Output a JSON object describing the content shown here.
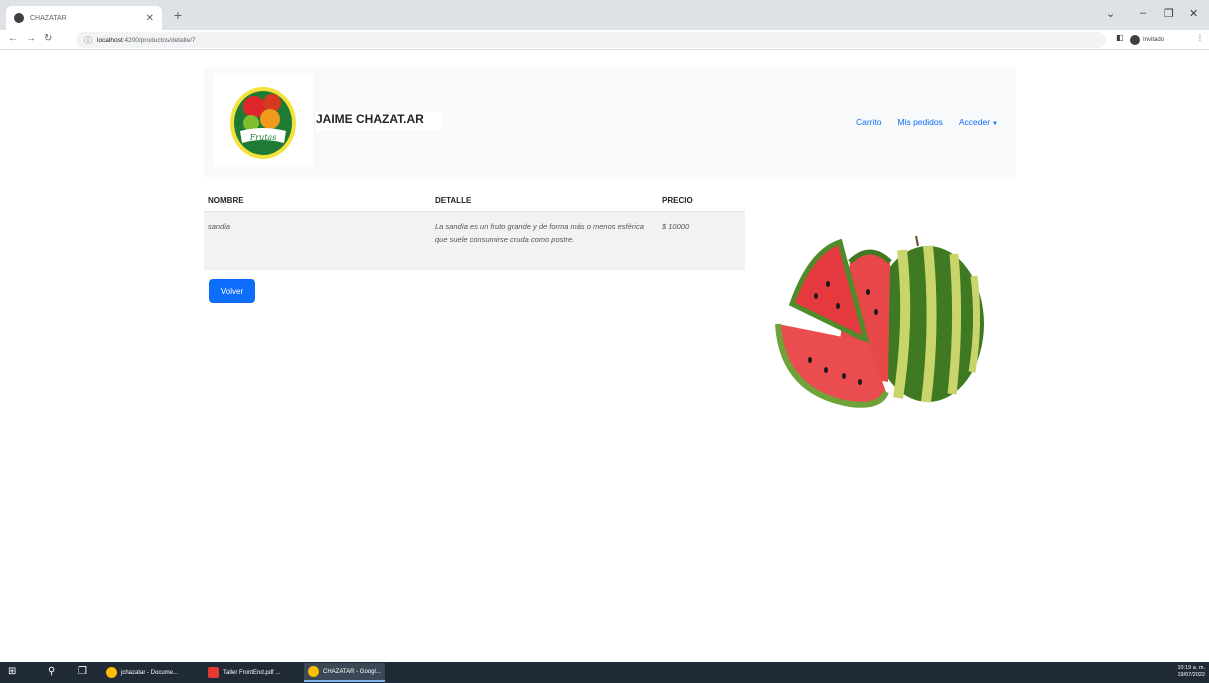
{
  "browser": {
    "tab_title": "CHAZATAR",
    "url_host": "localhost",
    "url_path": ":4200/productos/detalle/7",
    "profile_label": "Invitado"
  },
  "navbar": {
    "logo_text": "Frutas",
    "brand": "JAIME CHAZAT.AR",
    "links": [
      "Carrito",
      "Mis pedidos",
      "Acceder"
    ]
  },
  "table": {
    "headers": [
      "NOMBRE",
      "DETALLE",
      "PRECIO"
    ],
    "rows": [
      {
        "nombre": "sandia",
        "detalle": "La sandía es un fruto grande y de forma más o menos esférica que suele consumirse cruda como postre.",
        "precio": "$ 10000"
      }
    ]
  },
  "volver_label": "Volver",
  "taskbar": {
    "apps": [
      "jchazatar - Docume...",
      "Taller FrontEnd.pdf ...",
      "CHAZATAR - Googl..."
    ],
    "time": "10:19 a. m.",
    "date": "19/07/2022"
  }
}
